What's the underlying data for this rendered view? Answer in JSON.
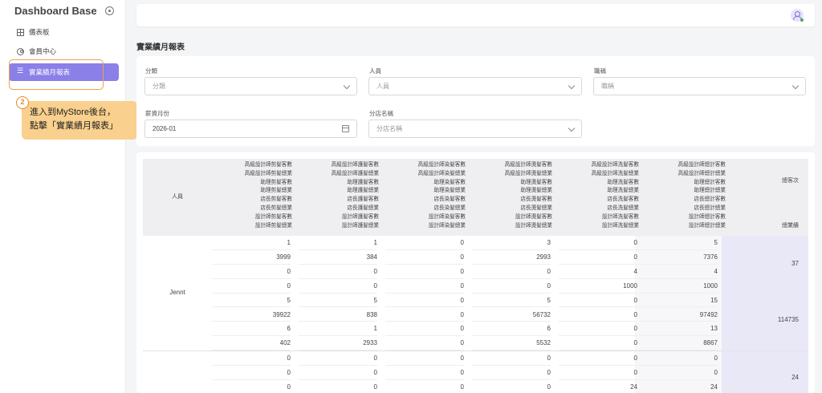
{
  "sidebar": {
    "brand": "Dashboard Base",
    "items": [
      {
        "label": "儀表板"
      },
      {
        "label": "會員中心"
      },
      {
        "label": "實業績月報表"
      }
    ]
  },
  "callout": {
    "step": "2",
    "line1": "進入到MyStore後台，",
    "line2": "點擊「實業績月報表」"
  },
  "page_title": "實業績月報表",
  "filters": {
    "category": {
      "label": "分類",
      "placeholder": "分類"
    },
    "person": {
      "label": "人員",
      "placeholder": "人員"
    },
    "title": {
      "label": "職稱",
      "placeholder": "職稱"
    },
    "month": {
      "label": "薪資月份",
      "value": "2026-01"
    },
    "store": {
      "label": "分店名稱",
      "placeholder": "分店名稱"
    }
  },
  "table": {
    "person_header": "人員",
    "columns": [
      [
        "高級設計師剪髮客數",
        "高級設計師剪髮總業",
        "助理剪髮客數",
        "助理剪髮總業",
        "店長剪髮客數",
        "店長剪髮總業",
        "設計師剪髮客數",
        "設計師剪髮總業"
      ],
      [
        "高級設計師護髮客數",
        "高級設計師護髮總業",
        "助理護髮客數",
        "助理護髮總業",
        "店長護髮客數",
        "店長護髮總業",
        "設計師護髮客數",
        "設計師護髮總業"
      ],
      [
        "高級設計師染髮客數",
        "高級設計師染髮總業",
        "助理染髮客數",
        "助理染髮總業",
        "店長染髮客數",
        "店長染髮總業",
        "設計師染髮客數",
        "設計師染髮總業"
      ],
      [
        "高級設計師燙髮客數",
        "高級設計師燙髮總業",
        "助理燙髮客數",
        "助理燙髮總業",
        "店長燙髮客數",
        "店長燙髮總業",
        "設計師燙髮客數",
        "設計師燙髮總業"
      ],
      [
        "高級設計師洗髮客數",
        "高級設計師洗髮總業",
        "助理洗髮客數",
        "助理洗髮總業",
        "店長洗髮客數",
        "店長洗髮總業",
        "設計師洗髮客數",
        "設計師洗髮總業"
      ],
      [
        "高級設計師總計客數",
        "高級設計師總計總業",
        "助理總計客數",
        "助理總計總業",
        "店長總計客數",
        "店長總計總業",
        "設計師總計客數",
        "設計師總計總業"
      ]
    ],
    "sum_headers": [
      "總客次",
      "總業績"
    ],
    "groups": [
      {
        "person": "Jennt",
        "rows": [
          [
            "1",
            "1",
            "0",
            "3",
            "0",
            "5"
          ],
          [
            "3999",
            "384",
            "0",
            "2993",
            "0",
            "7376"
          ],
          [
            "0",
            "0",
            "0",
            "0",
            "4",
            "4"
          ],
          [
            "0",
            "0",
            "0",
            "0",
            "1000",
            "1000"
          ],
          [
            "5",
            "5",
            "0",
            "5",
            "0",
            "15"
          ],
          [
            "39922",
            "838",
            "0",
            "56732",
            "0",
            "97492"
          ],
          [
            "6",
            "1",
            "0",
            "6",
            "0",
            "13"
          ],
          [
            "402",
            "2933",
            "0",
            "5532",
            "0",
            "8867"
          ]
        ],
        "sums": [
          "37",
          "114735"
        ]
      },
      {
        "person": "",
        "rows": [
          [
            "0",
            "0",
            "0",
            "0",
            "0",
            "0"
          ],
          [
            "0",
            "0",
            "0",
            "0",
            "0",
            "0"
          ],
          [
            "0",
            "0",
            "0",
            "0",
            "24",
            "24"
          ]
        ],
        "sums": [
          "24"
        ]
      }
    ]
  }
}
